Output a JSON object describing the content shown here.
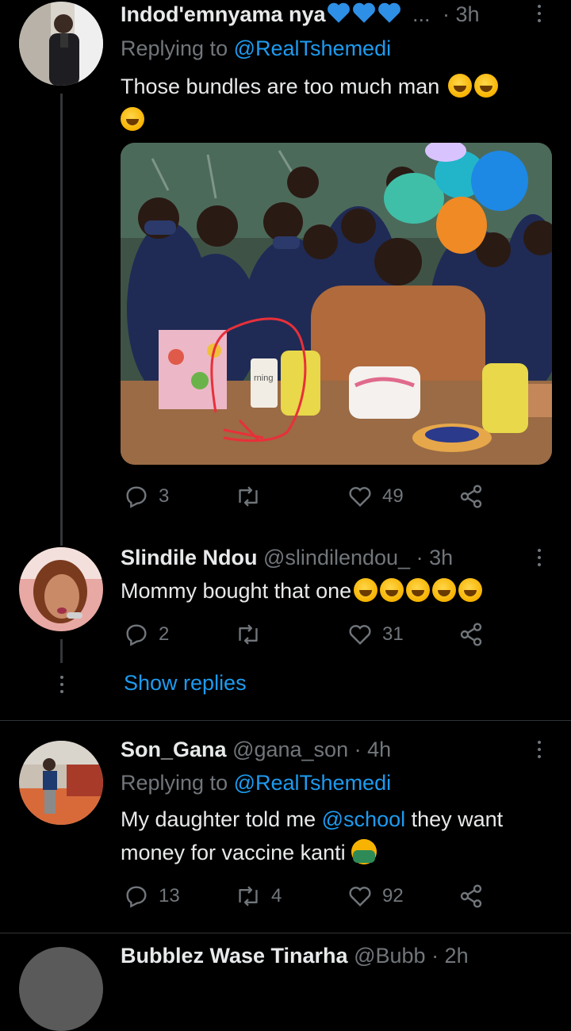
{
  "tweets": [
    {
      "display_name": "Indod'emnyama nya",
      "suffix": "...",
      "time": "· 3h",
      "replying_prefix": "Replying to ",
      "replying_handle": "@RealTshemedi",
      "text": "Those bundles are too much man",
      "replies": "3",
      "retweets": "",
      "likes": "49",
      "photo_mug_text": "rning"
    },
    {
      "display_name": "Slindile Ndou",
      "handle": "@slindilendou_",
      "time": "· 3h",
      "text": "Mommy bought that one",
      "replies": "2",
      "retweets": "",
      "likes": "31",
      "show_replies": "Show replies"
    },
    {
      "display_name": "Son_Gana",
      "handle": "@gana_son",
      "time": "· 4h",
      "replying_prefix": "Replying to ",
      "replying_handle": "@RealTshemedi",
      "text_before": "My daughter told me ",
      "mention": "@school",
      "text_after": " they want",
      "text_line2": "money for vaccine kanti",
      "replies": "13",
      "retweets": "4",
      "likes": "92"
    },
    {
      "display_name": "Bubblez Wase Tinarha",
      "handle": "@Bubb",
      "time": "· 2h"
    }
  ],
  "icons": {
    "reply": "reply-icon",
    "retweet": "retweet-icon",
    "like": "heart-icon",
    "share": "share-icon",
    "more": "more-icon"
  },
  "colors": {
    "accent": "#1d9bf0",
    "muted": "#71767b",
    "background": "#000000"
  }
}
